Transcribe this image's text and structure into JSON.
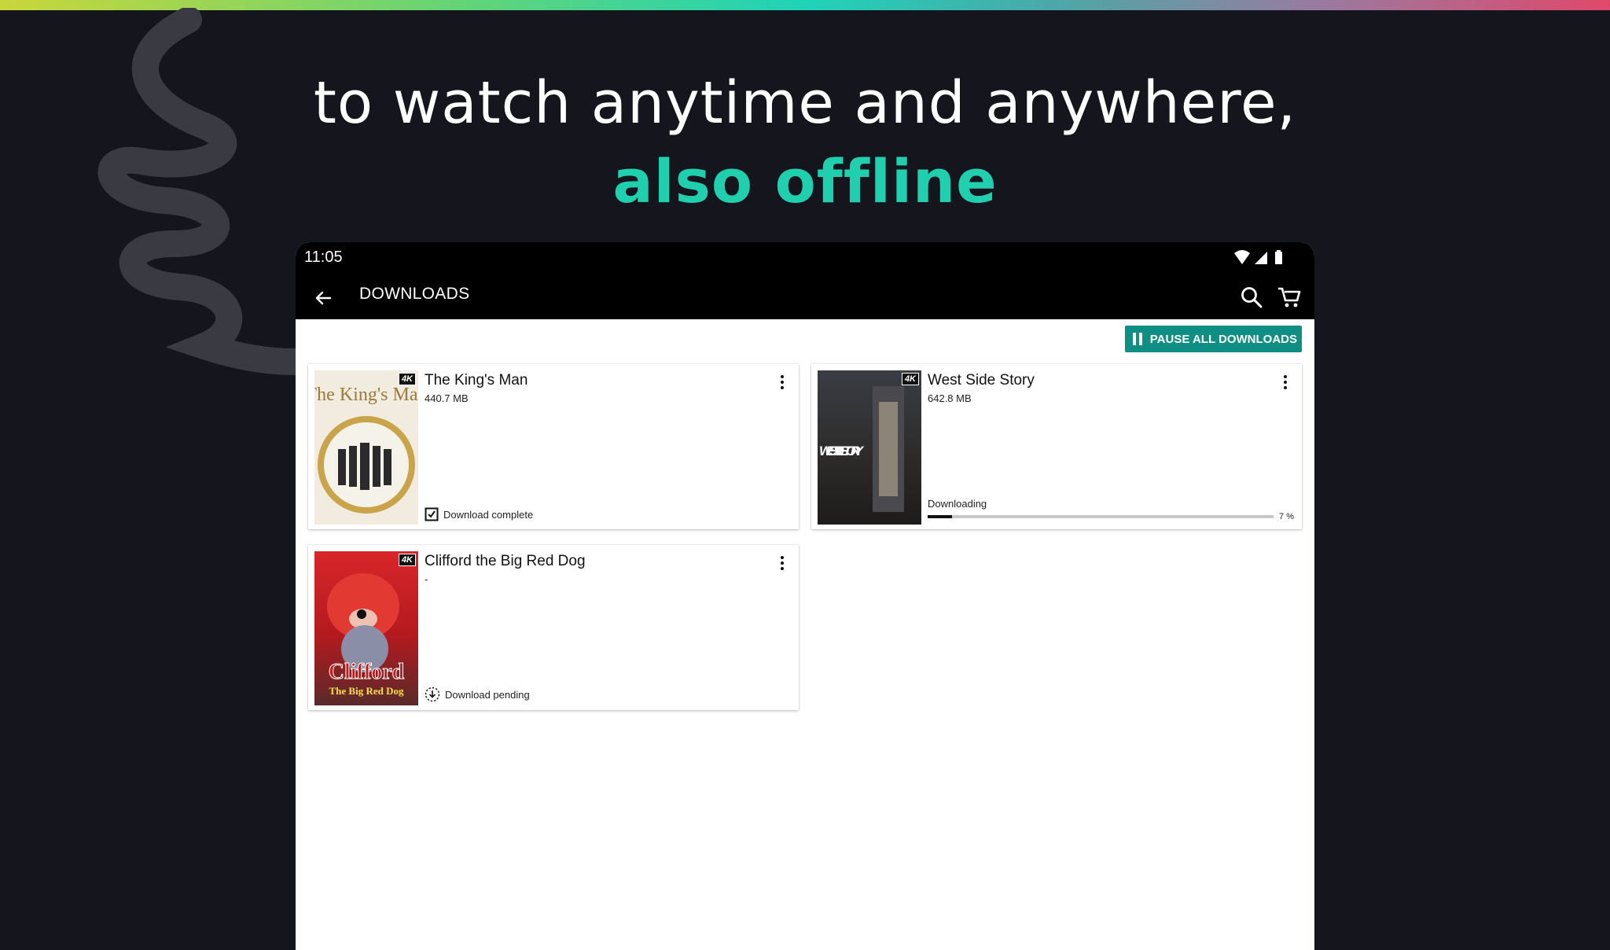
{
  "headline": {
    "line1": "to watch anytime and anywhere,",
    "line2": "also offline",
    "accent_color": "#1fcfae"
  },
  "status_bar": {
    "time": "11:05",
    "icons": [
      "wifi-icon",
      "cell-signal-icon",
      "battery-icon"
    ]
  },
  "app_bar": {
    "title": "DOWNLOADS",
    "icons": [
      "back-arrow-icon",
      "search-icon",
      "cart-icon"
    ]
  },
  "pause_all": {
    "label": "PAUSE ALL DOWNLOADS",
    "color": "#0f8f84"
  },
  "downloads": [
    {
      "title": "The King's Man",
      "size": "440.7 MB",
      "badge": "4K",
      "status": "Download complete",
      "poster_text": "The King's Man"
    },
    {
      "title": "West Side Story",
      "size": "642.8 MB",
      "badge": "4K",
      "status": "Downloading",
      "progress": 7,
      "progress_label": "7 %",
      "poster_text": "WEST SIDE STORY"
    },
    {
      "title": "Clifford the Big Red Dog",
      "size": "-",
      "badge": "4K",
      "status": "Download pending",
      "poster_text": "Clifford",
      "poster_subtext": "The Big Red Dog"
    }
  ]
}
